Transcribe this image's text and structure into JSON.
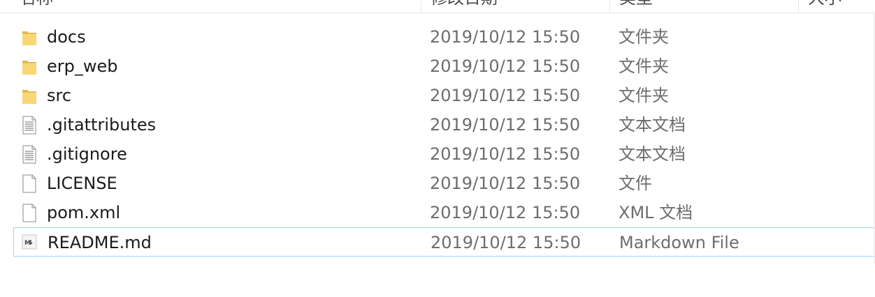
{
  "columns": {
    "name": "名称",
    "modified": "修改日期",
    "type": "类型",
    "size": "大小"
  },
  "files": [
    {
      "name": "docs",
      "date": "2019/10/12 15:50",
      "type": "文件夹",
      "icon": "folder-icon"
    },
    {
      "name": "erp_web",
      "date": "2019/10/12 15:50",
      "type": "文件夹",
      "icon": "folder-icon"
    },
    {
      "name": "src",
      "date": "2019/10/12 15:50",
      "type": "文件夹",
      "icon": "folder-icon"
    },
    {
      "name": ".gitattributes",
      "date": "2019/10/12 15:50",
      "type": "文本文档",
      "icon": "text-document-icon"
    },
    {
      "name": ".gitignore",
      "date": "2019/10/12 15:50",
      "type": "文本文档",
      "icon": "text-document-icon"
    },
    {
      "name": "LICENSE",
      "date": "2019/10/12 15:50",
      "type": "文件",
      "icon": "blank-file-icon"
    },
    {
      "name": "pom.xml",
      "date": "2019/10/12 15:50",
      "type": "XML 文档",
      "icon": "blank-file-icon"
    },
    {
      "name": "README.md",
      "date": "2019/10/12 15:50",
      "type": "Markdown File",
      "icon": "markdown-file-icon"
    }
  ],
  "colors": {
    "selection_border": "#99d1ff",
    "folder_yellow": "#f8d775",
    "secondary_text": "#6d6d6d"
  }
}
